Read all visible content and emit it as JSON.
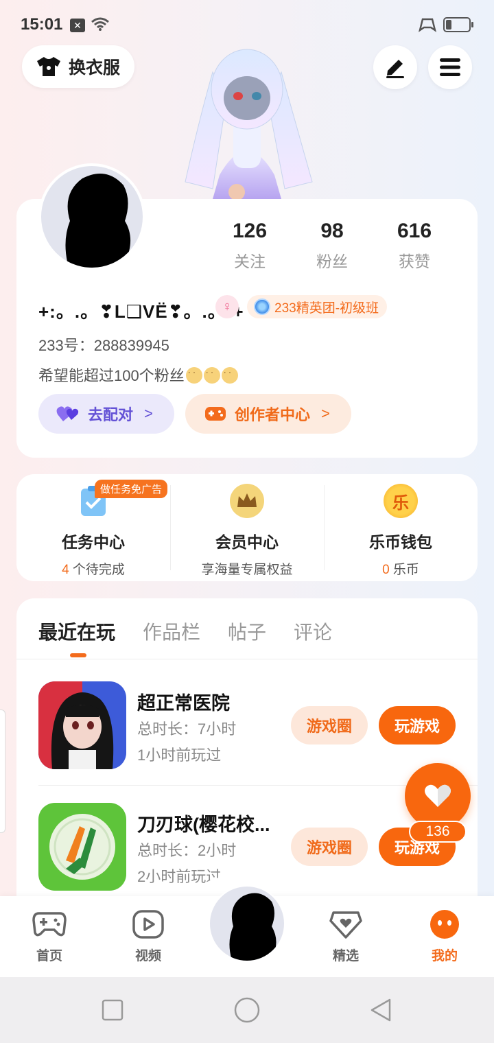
{
  "status": {
    "time": "15:01",
    "x_badge": "✕"
  },
  "header": {
    "outfit_label": "换衣服",
    "edit_icon": "pencil-icon",
    "menu_icon": "menu-icon"
  },
  "profile": {
    "stats": [
      {
        "value": "126",
        "label": "关注"
      },
      {
        "value": "98",
        "label": "粉丝"
      },
      {
        "value": "616",
        "label": "获赞"
      }
    ],
    "nickname": "+:。.。❣L❑VË❣。.。:+",
    "gender_symbol": "♀",
    "badge": "233精英团-初级班",
    "uid": "233号：288839945",
    "bio": "希望能超过100个粉丝",
    "match_label": "去配对",
    "creator_label": "创作者中心"
  },
  "services": [
    {
      "title": "任务中心",
      "count": "4",
      "sub": " 个待完成",
      "tag": "做任务免广告"
    },
    {
      "title": "会员中心",
      "sub": "享海量专属权益"
    },
    {
      "title": "乐币钱包",
      "count": "0",
      "sub": " 乐币",
      "coin": "乐"
    }
  ],
  "tabs": [
    "最近在玩",
    "作品栏",
    "帖子",
    "评论"
  ],
  "games": [
    {
      "name": "超正常医院",
      "duration": "总时长：7小时",
      "last": "1小时前玩过",
      "circle_label": "游戏圈",
      "play_label": "玩游戏"
    },
    {
      "name": "刀刃球(樱花校...",
      "duration": "总时长：2小时",
      "last": "2小时前玩过",
      "circle_label": "游戏圈",
      "play_label": "玩游戏"
    }
  ],
  "like_count": "136",
  "nav": [
    {
      "label": "首页",
      "icon": "gamepad-icon"
    },
    {
      "label": "视频",
      "icon": "video-icon"
    },
    {
      "label": "精选",
      "icon": "heart-badge-icon"
    },
    {
      "label": "我的",
      "icon": "face-icon"
    }
  ],
  "colors": {
    "accent": "#f8670e",
    "purple": "#6452d6"
  }
}
